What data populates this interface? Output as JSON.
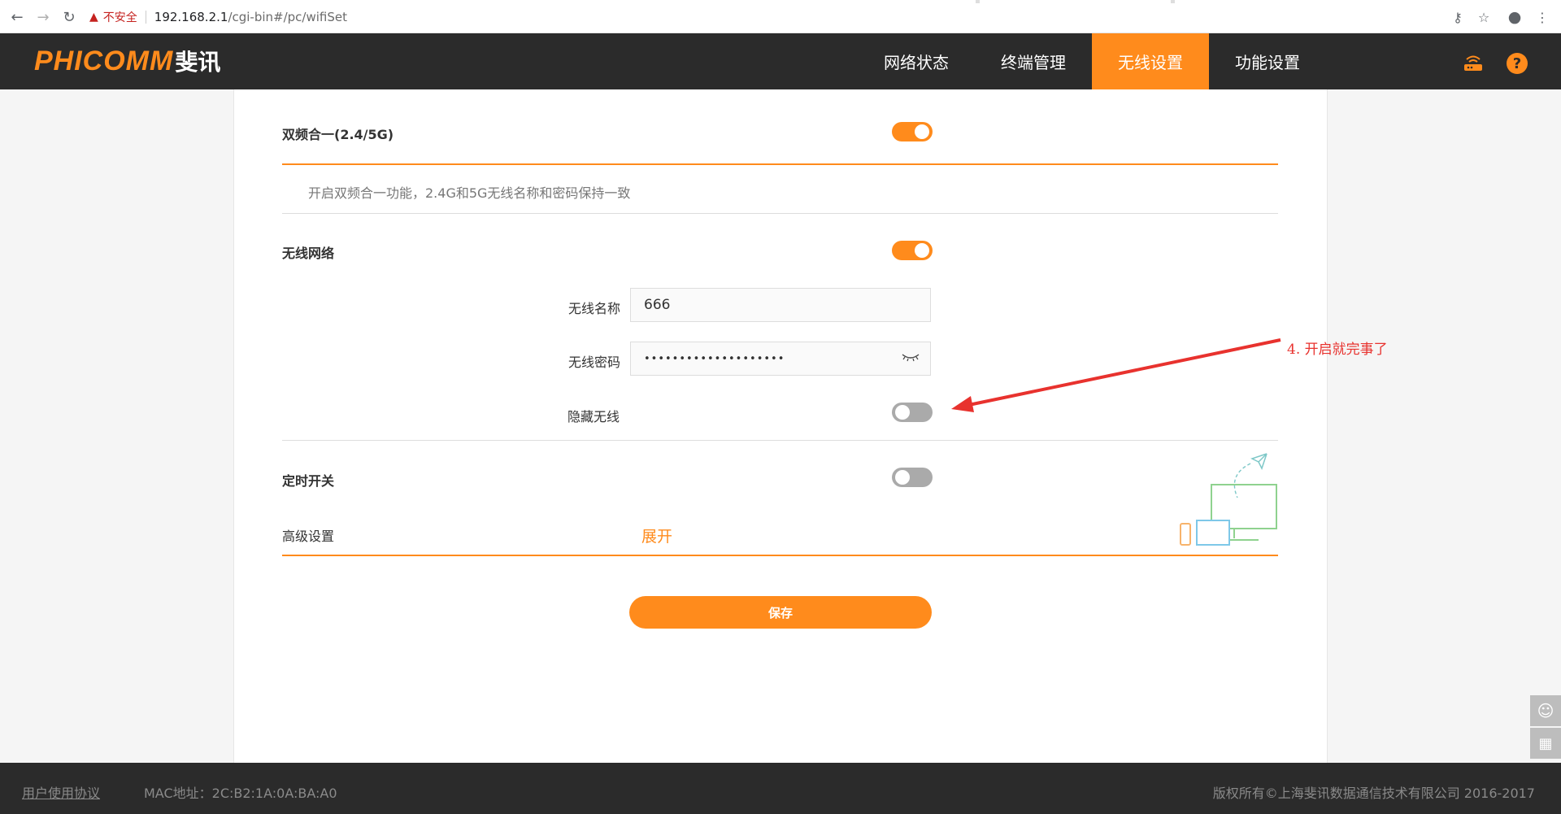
{
  "browser": {
    "security_label": "不安全",
    "url_host": "192.168.2.1",
    "url_path": "/cgi-bin#/pc/wifiSet"
  },
  "header": {
    "logo_en": "PHICOMM",
    "logo_cn": "斐讯",
    "menu": [
      {
        "label": "网络状态",
        "active": false
      },
      {
        "label": "终端管理",
        "active": false
      },
      {
        "label": "无线设置",
        "active": true
      },
      {
        "label": "功能设置",
        "active": false
      }
    ],
    "help_glyph": "?"
  },
  "settings": {
    "dual_band": {
      "label": "双频合一(2.4/5G)",
      "enabled": true,
      "description": "开启双频合一功能，2.4G和5G无线名称和密码保持一致"
    },
    "wireless": {
      "label": "无线网络",
      "enabled": true
    },
    "ssid": {
      "label": "无线名称",
      "value": "666"
    },
    "password": {
      "label": "无线密码",
      "value": "••••••••••••••••••••"
    },
    "hide_ssid": {
      "label": "隐藏无线",
      "enabled": false
    },
    "schedule": {
      "label": "定时开关",
      "enabled": false
    },
    "advanced": {
      "label": "高级设置",
      "expand_label": "展开"
    },
    "save_label": "保存"
  },
  "annotation": {
    "text": "4. 开启就完事了",
    "color": "#e8322e"
  },
  "footer": {
    "agreement": "用户使用协议",
    "mac": "MAC地址：2C:B2:1A:0A:BA:A0",
    "copyright": "版权所有©上海斐讯数据通信技术有限公司 2016-2017"
  },
  "colors": {
    "accent": "#ff8b1c",
    "header_bg": "#2b2b2b"
  }
}
